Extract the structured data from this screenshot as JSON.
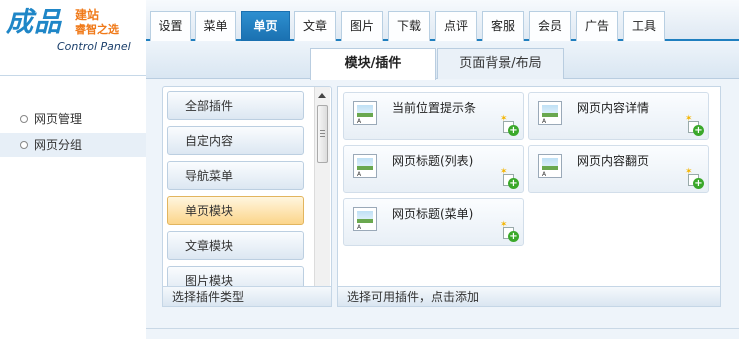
{
  "logo": {
    "main": "成品",
    "line1": "建站",
    "line2": "睿智之选",
    "line3": "Control Panel"
  },
  "sidebar": {
    "items": [
      {
        "label": "网页管理"
      },
      {
        "label": "网页分组"
      }
    ]
  },
  "top_tabs": [
    {
      "label": "设置"
    },
    {
      "label": "菜单"
    },
    {
      "label": "单页"
    },
    {
      "label": "文章"
    },
    {
      "label": "图片"
    },
    {
      "label": "下载"
    },
    {
      "label": "点评"
    },
    {
      "label": "客服"
    },
    {
      "label": "会员"
    },
    {
      "label": "广告"
    },
    {
      "label": "工具"
    }
  ],
  "active_top_tab": "单页",
  "sub_tabs": [
    {
      "label": "模块/插件"
    },
    {
      "label": "页面背景/布局"
    }
  ],
  "categories": [
    {
      "label": "全部插件"
    },
    {
      "label": "自定内容"
    },
    {
      "label": "导航菜单"
    },
    {
      "label": "单页模块"
    },
    {
      "label": "文章模块"
    },
    {
      "label": "图片模块"
    }
  ],
  "active_category": "单页模块",
  "category_footer": "选择插件类型",
  "plugins": [
    {
      "label": "当前位置提示条"
    },
    {
      "label": "网页内容详情"
    },
    {
      "label": "网页标题(列表)"
    },
    {
      "label": "网页内容翻页"
    },
    {
      "label": "网页标题(菜单)"
    }
  ],
  "plugin_footer": "选择可用插件，点击添加",
  "thumb_text": "A",
  "colors": {
    "brand": "#1f86c7",
    "accent": "#f07a1a",
    "active_tab": "#1a70b0",
    "active_category": "#fcd58a"
  }
}
